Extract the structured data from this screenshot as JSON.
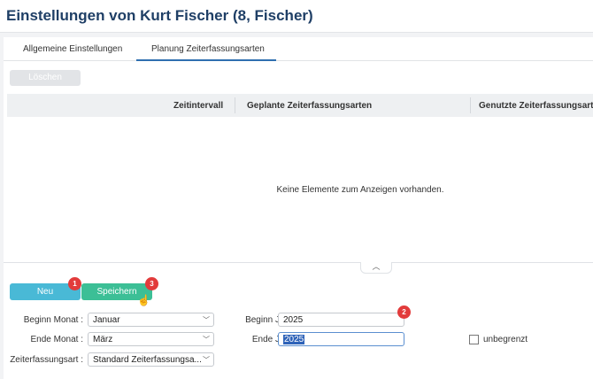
{
  "window": {
    "title": "Einstellungen von Kurt Fischer (8, Fischer)"
  },
  "tabs": [
    {
      "label": "Allgemeine Einstellungen",
      "active": false
    },
    {
      "label": "Planung Zeiterfassungsarten",
      "active": true
    }
  ],
  "toolbar": {
    "delete_label": "Löschen"
  },
  "grid": {
    "columns": [
      "Zeitintervall",
      "Geplante Zeiterfassungsarten",
      "Genutzte Zeiterfassungsart"
    ],
    "empty_message": "Keine Elemente zum Anzeigen vorhanden."
  },
  "actions": {
    "new_label": "Neu",
    "save_label": "Speichern"
  },
  "badges": {
    "new": "1",
    "year_start": "2",
    "save": "3"
  },
  "form": {
    "begin_month": {
      "label": "Beginn Monat :",
      "value": "Januar"
    },
    "end_month": {
      "label": "Ende Monat :",
      "value": "März"
    },
    "time_type": {
      "label": "Zeiterfassungsart :",
      "value": "Standard Zeiterfassungsa..."
    },
    "begin_year": {
      "label": "Beginn Jahr :",
      "value": "2025"
    },
    "end_year": {
      "label": "Ende Jahr :",
      "value": "2025"
    },
    "unlimited": {
      "label": "unbegrenzt",
      "checked": false
    }
  },
  "icons": {
    "collapse": "chevron-up-icon",
    "dropdown": "chevron-down-icon",
    "cursor": "hand-pointer-icon"
  },
  "colors": {
    "title": "#1f3f66",
    "new_button": "#49b9d6",
    "save_button": "#3cbf96",
    "badge": "#e23b3b",
    "tab_underline": "#2f6fb0"
  }
}
